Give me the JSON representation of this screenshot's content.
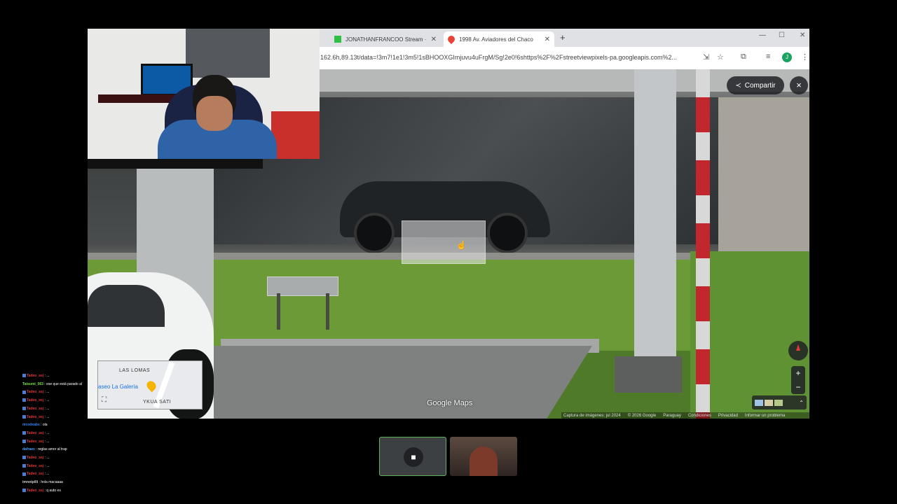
{
  "browser": {
    "tabs": [
      {
        "label": "JONATHANFRANCOO Stream ·",
        "icon": "twitch-icon"
      },
      {
        "label": "1998 Av. Aviadores del Chaco",
        "icon": "maps-pin-icon"
      }
    ],
    "new_tab_label": "+",
    "url": "162.6h,89.13t/data=!3m7!1e1!3m5!1sBHOOXGImjuvu4uFrgM/Sg!2e0!6shttps%2F%2Fstreetviewpixels-pa.googleapis.com%2...",
    "profile_initial": "J"
  },
  "maps": {
    "share_label": "Compartir",
    "close_label": "×",
    "brand_label": "Google Maps",
    "zoom_in": "+",
    "zoom_out": "−",
    "minimap": {
      "area_top": "LAS LOMAS",
      "place": "aseo La Galería",
      "area_bottom": "YKUA SATI"
    },
    "footer": [
      "Captura de imágenes: jul 2024",
      "© 2026 Google",
      "Paraguay",
      "Condiciones",
      "Privacidad",
      "Informar un problema"
    ]
  },
  "chat": [
    {
      "user": "Tadeo_ssj",
      "msg": " : ...",
      "color": "#e23a3a",
      "badge": true
    },
    {
      "user": "Tatsumi_063",
      "msg": " : ese que está parado al",
      "color": "#7be04b",
      "badge": false
    },
    {
      "user": "Tadeo_ssj",
      "msg": " : ...",
      "color": "#e23a3a",
      "badge": true
    },
    {
      "user": "Tadeo_ssj",
      "msg": " : ...",
      "color": "#e23a3a",
      "badge": true
    },
    {
      "user": "Tadeo_ssj",
      "msg": " : ...",
      "color": "#e23a3a",
      "badge": true
    },
    {
      "user": "Tadeo_ssj",
      "msg": " : ...",
      "color": "#e23a3a",
      "badge": true
    },
    {
      "user": "nicodeabs",
      "msg": " : ola",
      "color": "#3b82f6",
      "badge": false
    },
    {
      "user": "Tadeo_ssj",
      "msg": " : ...",
      "color": "#e23a3a",
      "badge": true
    },
    {
      "user": "Tadeo_ssj",
      "msg": " : ...",
      "color": "#e23a3a",
      "badge": true
    },
    {
      "user": "dafraes",
      "msg": " : reglas amor al trap",
      "color": "#4ea0ff",
      "badge": false
    },
    {
      "user": "Tadeo_ssj",
      "msg": " : ...",
      "color": "#e23a3a",
      "badge": true
    },
    {
      "user": "Tadeo_ssj",
      "msg": " : ...",
      "color": "#e23a3a",
      "badge": true
    },
    {
      "user": "Tadeo_ssj",
      "msg": " : ...",
      "color": "#e23a3a",
      "badge": true
    },
    {
      "user": "imnotpilli",
      "msg": " : hola macaaaa",
      "color": "#cfcfcf",
      "badge": false
    },
    {
      "user": "Tadeo_ssj",
      "msg": " : q auto es",
      "color": "#e23a3a",
      "badge": true
    }
  ],
  "call": {
    "cam_icon": "■",
    "tiles": [
      "camera-tile",
      "participant-video-tile"
    ]
  },
  "colors": {
    "maps_accent": "#1a73e8",
    "chat_red": "#e23a3a",
    "tile_border": "#5fb35f"
  }
}
